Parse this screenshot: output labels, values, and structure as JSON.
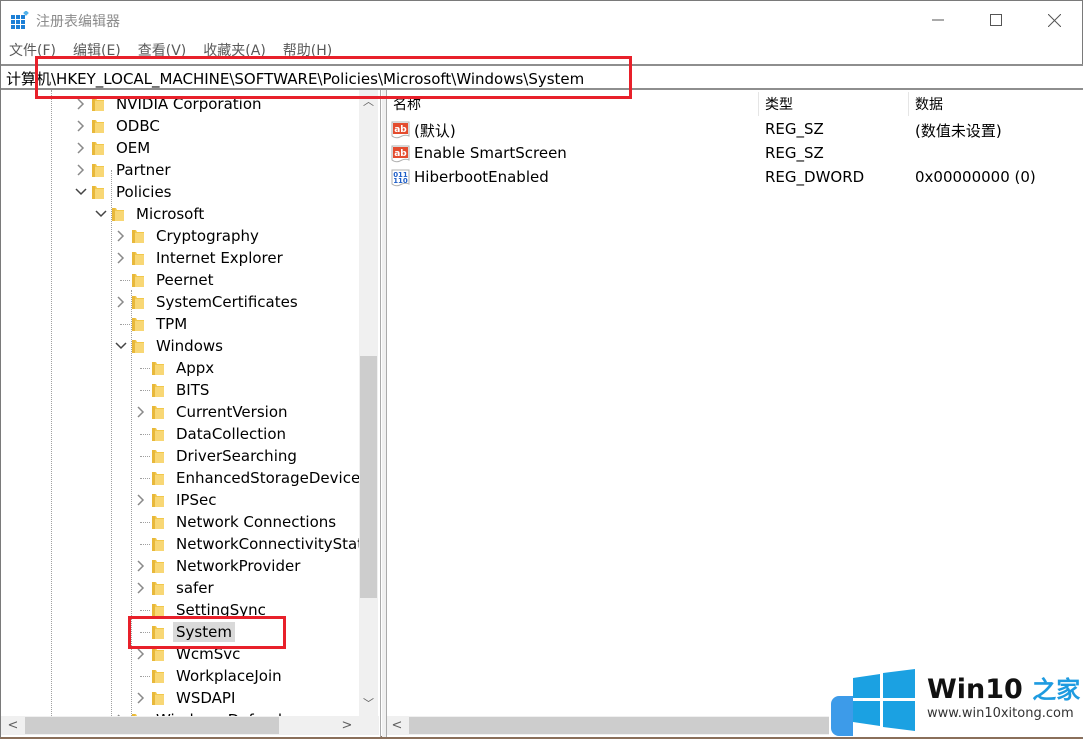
{
  "window": {
    "title": "注册表编辑器",
    "controls": {
      "minimize": "—",
      "maximize": "☐",
      "close": "✕"
    }
  },
  "menu": [
    "文件(F)",
    "编辑(E)",
    "查看(V)",
    "收藏夹(A)",
    "帮助(H)"
  ],
  "address": {
    "path": "计算机\\HKEY_LOCAL_MACHINE\\SOFTWARE\\Policies\\Microsoft\\Windows\\System"
  },
  "tree": {
    "items": [
      {
        "label": "NVIDIA Corporation",
        "level": 0,
        "expander": "collapsed"
      },
      {
        "label": "ODBC",
        "level": 0,
        "expander": "collapsed"
      },
      {
        "label": "OEM",
        "level": 0,
        "expander": "collapsed"
      },
      {
        "label": "Partner",
        "level": 0,
        "expander": "collapsed"
      },
      {
        "label": "Policies",
        "level": 0,
        "expander": "expanded"
      },
      {
        "label": "Microsoft",
        "level": 1,
        "expander": "expanded"
      },
      {
        "label": "Cryptography",
        "level": 2,
        "expander": "collapsed"
      },
      {
        "label": "Internet Explorer",
        "level": 2,
        "expander": "collapsed"
      },
      {
        "label": "Peernet",
        "level": 2,
        "expander": "none"
      },
      {
        "label": "SystemCertificates",
        "level": 2,
        "expander": "collapsed"
      },
      {
        "label": "TPM",
        "level": 2,
        "expander": "none"
      },
      {
        "label": "Windows",
        "level": 2,
        "expander": "expanded"
      },
      {
        "label": "Appx",
        "level": 3,
        "expander": "none"
      },
      {
        "label": "BITS",
        "level": 3,
        "expander": "none"
      },
      {
        "label": "CurrentVersion",
        "level": 3,
        "expander": "collapsed"
      },
      {
        "label": "DataCollection",
        "level": 3,
        "expander": "none"
      },
      {
        "label": "DriverSearching",
        "level": 3,
        "expander": "none"
      },
      {
        "label": "EnhancedStorageDevices",
        "level": 3,
        "expander": "none"
      },
      {
        "label": "IPSec",
        "level": 3,
        "expander": "collapsed"
      },
      {
        "label": "Network Connections",
        "level": 3,
        "expander": "none"
      },
      {
        "label": "NetworkConnectivityStatusIndicator",
        "level": 3,
        "expander": "none"
      },
      {
        "label": "NetworkProvider",
        "level": 3,
        "expander": "collapsed"
      },
      {
        "label": "safer",
        "level": 3,
        "expander": "collapsed"
      },
      {
        "label": "SettingSync",
        "level": 3,
        "expander": "none"
      },
      {
        "label": "System",
        "level": 3,
        "expander": "none",
        "selected": true
      },
      {
        "label": "WcmSvc",
        "level": 3,
        "expander": "collapsed"
      },
      {
        "label": "WorkplaceJoin",
        "level": 3,
        "expander": "none"
      },
      {
        "label": "WSDAPI",
        "level": 3,
        "expander": "collapsed"
      },
      {
        "label": "Windows Defender",
        "level": 2,
        "expander": "collapsed"
      }
    ]
  },
  "values": {
    "columns": [
      "名称",
      "类型",
      "数据"
    ],
    "rows": [
      {
        "icon": "string-value-icon",
        "name": "(默认)",
        "type": "REG_SZ",
        "data": "(数值未设置)"
      },
      {
        "icon": "string-value-icon",
        "name": "Enable SmartScreen",
        "type": "REG_SZ",
        "data": ""
      },
      {
        "icon": "binary-value-icon",
        "name": "HiberbootEnabled",
        "type": "REG_DWORD",
        "data": "0x00000000 (0)"
      }
    ]
  },
  "watermark": {
    "brand": "Win10",
    "brand_zh": "之家",
    "url": "www.win10xitong.com"
  },
  "colors": {
    "highlight_box": "#e8202a",
    "folder": "#f2c84b",
    "selection": "#d9d9d9",
    "brand_blue": "#1e9be0"
  }
}
